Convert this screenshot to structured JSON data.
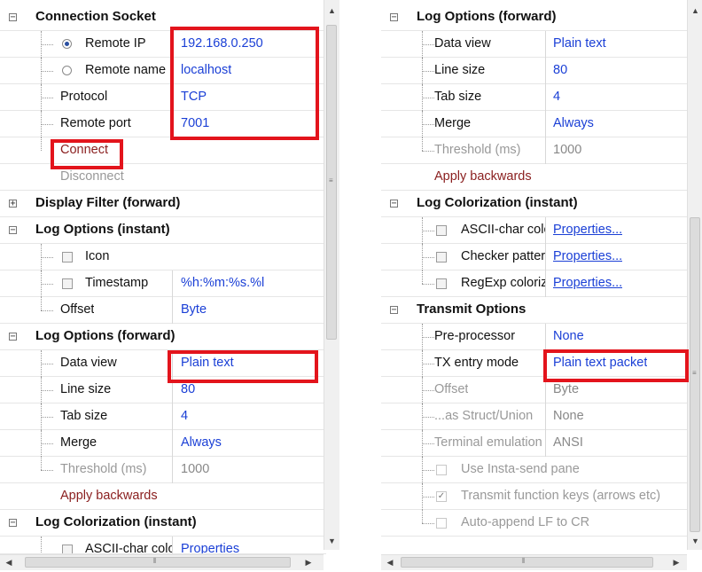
{
  "left_panel": {
    "connection_socket": {
      "title": "Connection Socket",
      "remote_ip_label": "Remote IP",
      "remote_ip_value": "192.168.0.250",
      "remote_name_label": "Remote name",
      "remote_name_value": "localhost",
      "protocol_label": "Protocol",
      "protocol_value": "TCP",
      "remote_port_label": "Remote port",
      "remote_port_value": "7001",
      "connect_label": "Connect",
      "disconnect_label": "Disconnect"
    },
    "display_filter": {
      "title": "Display Filter (forward)"
    },
    "log_options_instant": {
      "title": "Log Options (instant)",
      "icon_label": "Icon",
      "timestamp_label": "Timestamp",
      "timestamp_value": "%h:%m:%s.%l",
      "offset_label": "Offset",
      "offset_value": "Byte"
    },
    "log_options_forward": {
      "title": "Log Options (forward)",
      "data_view_label": "Data view",
      "data_view_value": "Plain text",
      "line_size_label": "Line size",
      "line_size_value": "80",
      "tab_size_label": "Tab size",
      "tab_size_value": "4",
      "merge_label": "Merge",
      "merge_value": "Always",
      "threshold_label": "Threshold (ms)",
      "threshold_value": "1000",
      "apply_backwards_label": "Apply backwards"
    },
    "log_colorization": {
      "title": "Log Colorization (instant)",
      "ascii_label": "ASCII-char color",
      "ascii_value": "Properties"
    }
  },
  "right_panel": {
    "log_options_forward": {
      "title": "Log Options (forward)",
      "data_view_label": "Data view",
      "data_view_value": "Plain text",
      "line_size_label": "Line size",
      "line_size_value": "80",
      "tab_size_label": "Tab size",
      "tab_size_value": "4",
      "merge_label": "Merge",
      "merge_value": "Always",
      "threshold_label": "Threshold (ms)",
      "threshold_value": "1000",
      "apply_backwards_label": "Apply backwards"
    },
    "log_colorization": {
      "title": "Log Colorization (instant)",
      "ascii_label": "ASCII-char color",
      "ascii_value": "Properties...",
      "checker_label": "Checker pattern",
      "checker_value": "Properties...",
      "regexp_label": "RegExp colorization",
      "regexp_value": "Properties..."
    },
    "transmit_options": {
      "title": "Transmit Options",
      "preprocessor_label": "Pre-processor",
      "preprocessor_value": "None",
      "tx_entry_label": "TX entry mode",
      "tx_entry_value": "Plain text packet",
      "offset_label": "Offset",
      "offset_value": "Byte",
      "struct_label": "...as Struct/Union",
      "struct_value": "None",
      "terminal_label": "Terminal emulation",
      "terminal_value": "ANSI",
      "insta_send_label": "Use Insta-send pane",
      "transmit_fkeys_label": "Transmit function keys (arrows etc)",
      "auto_append_label": "Auto-append LF to CR"
    }
  },
  "colors": {
    "value_blue": "#1a3fd6",
    "action_red": "#8b2020",
    "highlight_red": "#e3141c"
  }
}
